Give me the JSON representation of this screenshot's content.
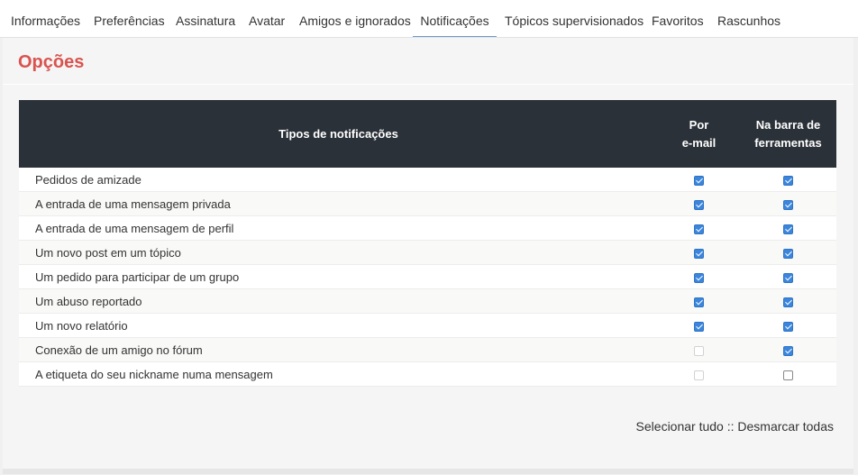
{
  "tabs": [
    {
      "label": "Informações"
    },
    {
      "label": "Preferências"
    },
    {
      "label": "Assinatura"
    },
    {
      "label": "Avatar"
    },
    {
      "label": "Amigos e ignorados"
    },
    {
      "label": "Notificações"
    },
    {
      "label": "Tópicos supervisionados"
    },
    {
      "label": "Favoritos"
    },
    {
      "label": "Rascunhos"
    }
  ],
  "active_tab": "Notificações",
  "section_title": "Opções",
  "table": {
    "headers": {
      "type": "Tipos de notificações",
      "email_line1": "Por",
      "email_line2": "e-mail",
      "bar_line1": "Na barra de",
      "bar_line2": "ferramentas"
    },
    "rows": [
      {
        "label": "Pedidos de amizade",
        "email": "checked",
        "bar": "checked"
      },
      {
        "label": "A entrada de uma mensagem privada",
        "email": "checked",
        "bar": "checked"
      },
      {
        "label": "A entrada de uma mensagem de perfil",
        "email": "checked",
        "bar": "checked"
      },
      {
        "label": "Um novo post em um tópico",
        "email": "checked",
        "bar": "checked"
      },
      {
        "label": "Um pedido para participar de um grupo",
        "email": "checked",
        "bar": "checked"
      },
      {
        "label": "Um abuso reportado",
        "email": "checked",
        "bar": "checked"
      },
      {
        "label": "Um novo relatório",
        "email": "checked",
        "bar": "checked"
      },
      {
        "label": "Conexão de um amigo no fórum",
        "email": "disabled",
        "bar": "checked"
      },
      {
        "label": "A etiqueta do seu nickname numa mensagem",
        "email": "disabled",
        "bar": "unchecked"
      }
    ]
  },
  "footer": {
    "select_all": "Selecionar tudo",
    "separator": " :: ",
    "deselect_all": "Desmarcar todas"
  },
  "colors": {
    "accent_title": "#d9534f",
    "header_bg": "#2b3138",
    "checkbox_blue": "#3b86dc",
    "active_tab_underline": "#6a9ad0"
  }
}
